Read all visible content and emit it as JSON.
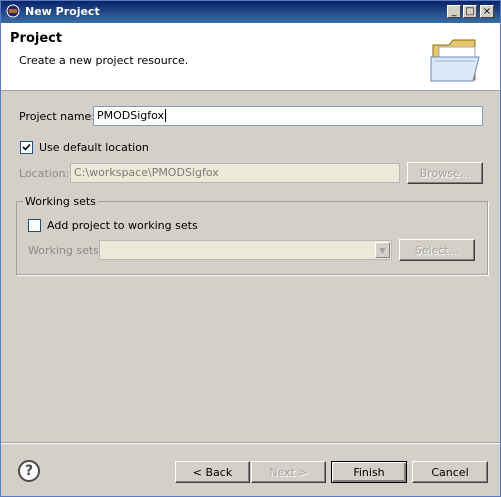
{
  "window": {
    "title": "New Project"
  },
  "title_buttons": {
    "minimize": "_",
    "maximize": "□",
    "close": "×"
  },
  "header": {
    "title": "Project",
    "description": "Create a new project resource."
  },
  "project_name": {
    "label": "Project name:",
    "value": "PMODSigfox"
  },
  "use_default_location": {
    "label": "Use default location",
    "checked": true
  },
  "location": {
    "label": "Location:",
    "value": "C:\\workspace\\PMODSigfox",
    "browse_label": "Browse..."
  },
  "working_sets": {
    "group_label": "Working sets",
    "add_label": "Add project to working sets",
    "add_checked": false,
    "sets_label": "Working sets:",
    "sets_value": "",
    "select_label": "Select..."
  },
  "footer": {
    "help_icon": "?",
    "back_label": "< Back",
    "next_label": "Next >",
    "finish_label": "Finish",
    "cancel_label": "Cancel"
  },
  "colors": {
    "titlebar": "#0a246a",
    "dialog_bg": "#d4d0c8",
    "header_bg": "#ffffff"
  },
  "icons": [
    "eclipse-app-icon",
    "folder-icon",
    "help-icon",
    "checkbox-check-icon",
    "dropdown-arrow-icon"
  ]
}
